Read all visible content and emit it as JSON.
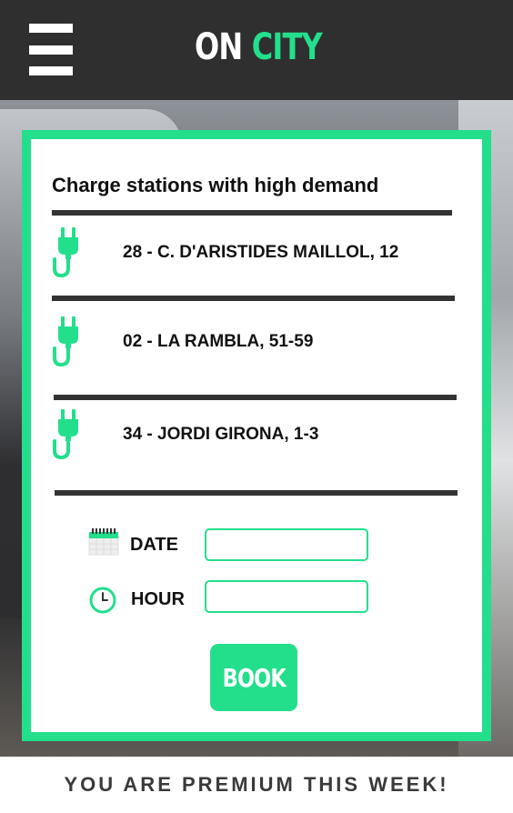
{
  "header": {
    "logo_part1": "ON",
    "logo_part2": "CITY",
    "menu_icon": "hamburger-menu-icon"
  },
  "colors": {
    "accent": "#23df8c",
    "header_bg": "#2f2f2f",
    "text_dark": "#111111",
    "divider": "#333333"
  },
  "card": {
    "title": "Charge stations with high demand",
    "stations": [
      {
        "label": "28 - C. D'ARISTIDES MAILLOL, 12",
        "icon": "plug-icon"
      },
      {
        "label": "02 - LA RAMBLA, 51-59",
        "icon": "plug-icon"
      },
      {
        "label": "34 - JORDI GIRONA, 1-3",
        "icon": "plug-icon"
      }
    ],
    "date": {
      "label": "DATE",
      "value": "",
      "icon": "calendar-icon"
    },
    "hour": {
      "label": "HOUR",
      "value": "",
      "icon": "clock-icon"
    },
    "book_label": "BOOK"
  },
  "footer": {
    "premium_text": "YOU ARE PREMIUM THIS WEEK!"
  }
}
